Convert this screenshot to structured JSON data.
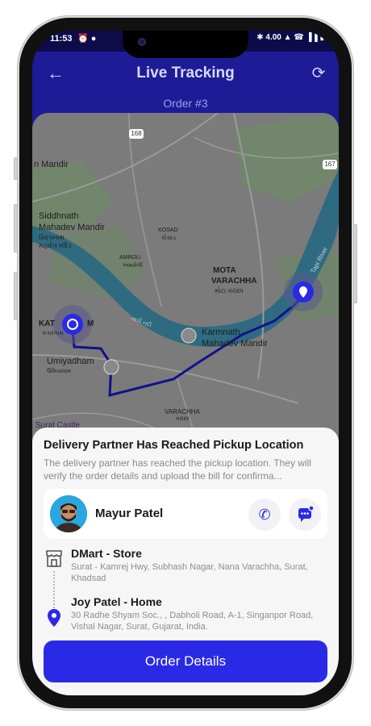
{
  "status_bar": {
    "time": "11:53",
    "left_icons": "⏰ ●",
    "right_icons": "✱ 4.00 ▲ ☎ ▐▐ ▮"
  },
  "header": {
    "title": "Live Tracking",
    "order_label": "Order #3"
  },
  "map": {
    "labels": {
      "mandir_top": "n Mandir",
      "siddhnath_1": "Siddhnath",
      "siddhnath_2": "Mahadev Mandir",
      "siddhnath_guj1": "સિદ્ધનાથ",
      "siddhnath_guj2": "મહાદેવ મંદિર",
      "kosad": "KOSAD",
      "kosad_guj": "કોસાડ",
      "amroli": "AMROLI",
      "amroli_guj": "અમરોલી",
      "mota_1": "MOTA",
      "mota_2": "VARACHHA",
      "mota_guj": "મોટા વરાછા",
      "tapi": "Tapi River",
      "tapi_guj": "તાપી નદી",
      "katargam": "KAT",
      "katargam_m": "M",
      "katargam_guj": "કતારગામ",
      "umiyadham": "Umiyadham",
      "umiyadham_guj": "ઉમિયાધામ",
      "karmnath_1": "Karmnath",
      "karmnath_2": "Mahadev Mandir",
      "varachha": "VARACHHA",
      "varachha_guj": "વરાછા",
      "surat_castle": "Surat Castle",
      "road_168": "168",
      "road_167": "167"
    }
  },
  "sheet": {
    "title": "Delivery Partner Has Reached Pickup Location",
    "description": "The delivery partner has reached the pickup location. They will verify the order details and upload the bill for confirma...",
    "partner_name": "Mayur Patel",
    "pickup": {
      "title": "DMart - Store",
      "address": "Surat - Kamrej Hwy, Subhash Nagar, Nana Varachha, Surat, Khadsad"
    },
    "drop": {
      "title": "Joy Patel - Home",
      "address": "30 Radhe Shyam Soc., , Dabholi Road, A-1, Singanpor Road, Vishal Nagar, Surat, Gujarat, India."
    },
    "order_button": "Order Details"
  },
  "colors": {
    "primary": "#2a2ae6",
    "header_bg": "#1e1b96",
    "river": "#2f6b80",
    "route": "#12128a"
  },
  "icons": {
    "back": "arrow-left-icon",
    "refresh": "refresh-icon",
    "call": "phone-icon",
    "chat": "chat-icon",
    "pickup": "store-icon",
    "drop": "location-pin-icon"
  }
}
